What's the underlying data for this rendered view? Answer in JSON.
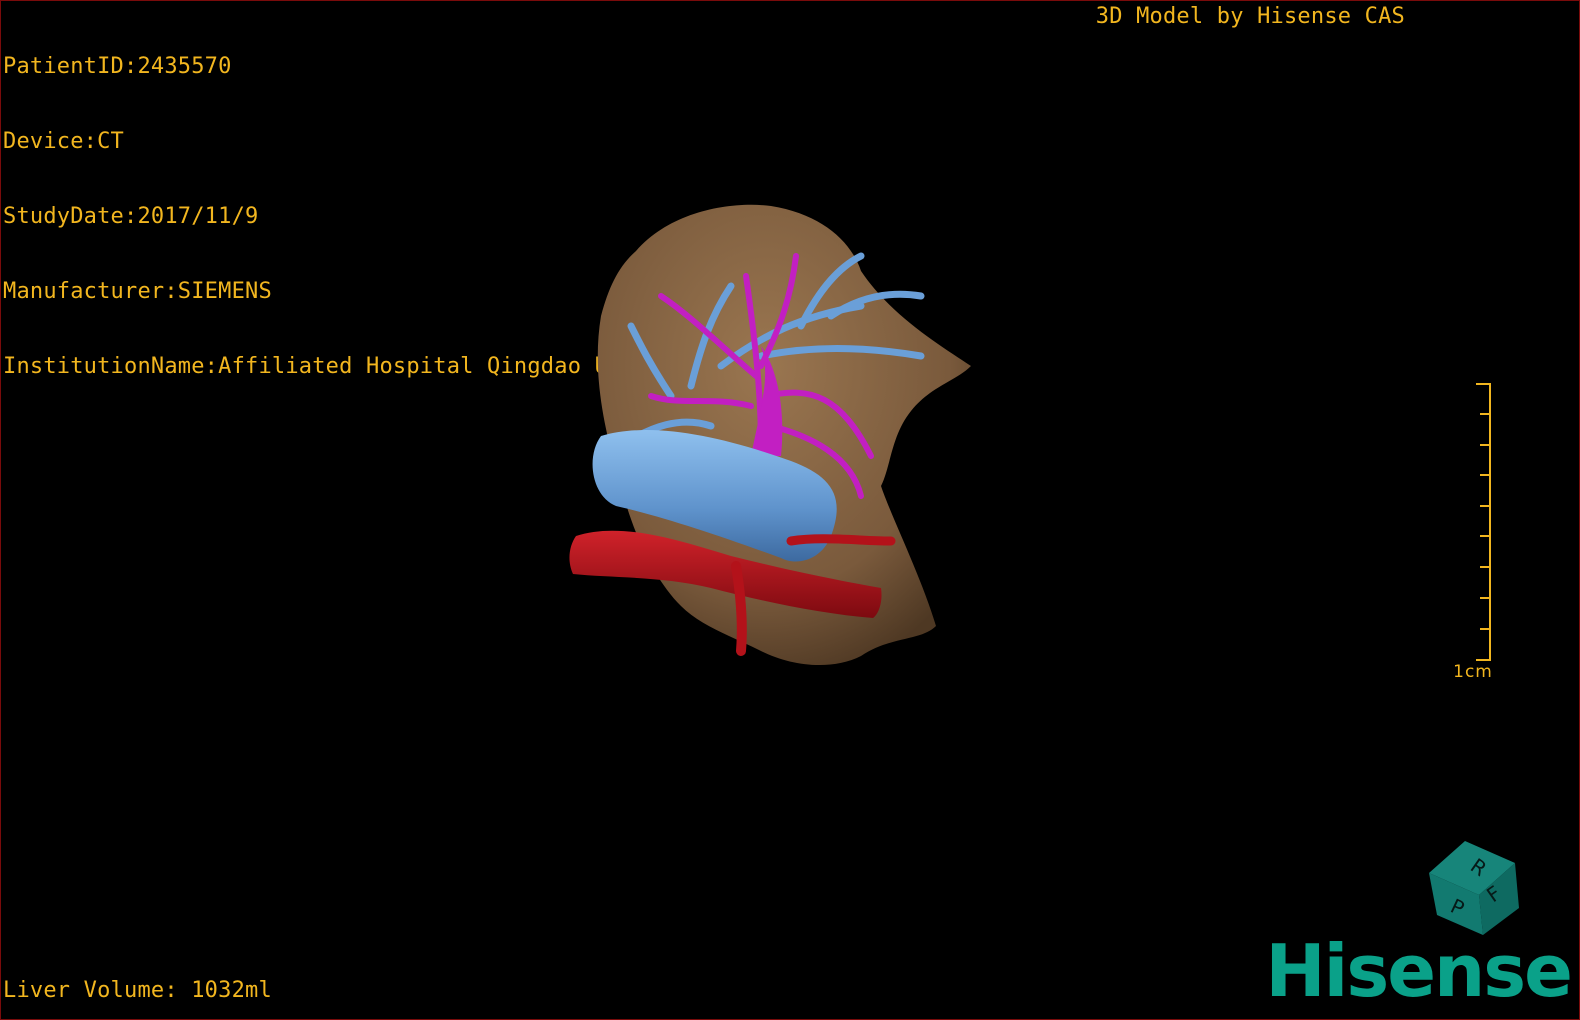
{
  "overlay": {
    "patient_id": "PatientID:2435570",
    "device": "Device:CT",
    "study_date": "StudyDate:2017/11/9",
    "manufacturer": "Manufacturer:SIEMENS",
    "institution": "InstitutionName:Affiliated Hospital Qingdao University-C",
    "model_credit": "3D Model by Hisense CAS",
    "liver_volume": "Liver Volume: 1032ml"
  },
  "scale": {
    "label": "1cm"
  },
  "orientation_cube": {
    "face_top": "R",
    "face_right": "F",
    "face_left": "P"
  },
  "logo": {
    "text": "Hisense"
  },
  "colors": {
    "overlay_text": "#f2b61f",
    "liver": "#7a5a3c",
    "portal_vein": "#6a9fd8",
    "hepatic_vein": "#c21fc2",
    "artery": "#b3121a",
    "logo": "#0aa189"
  }
}
